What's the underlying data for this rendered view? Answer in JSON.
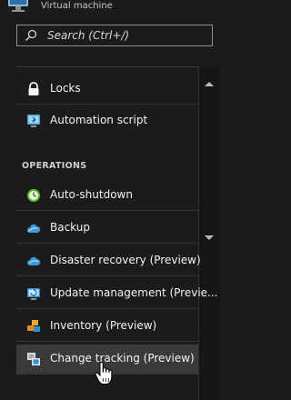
{
  "header": {
    "title": "Virtual machine",
    "icon": "monitor-icon"
  },
  "search": {
    "placeholder": "Search (Ctrl+/)"
  },
  "menu": {
    "items_top": [
      {
        "label": "Locks",
        "icon": "lock-icon"
      },
      {
        "label": "Automation script",
        "icon": "script-download-icon"
      }
    ],
    "section_operations": "OPERATIONS",
    "items_operations": [
      {
        "label": "Auto-shutdown",
        "icon": "clock-icon"
      },
      {
        "label": "Backup",
        "icon": "cloud-backup-icon"
      },
      {
        "label": "Disaster recovery (Preview)",
        "icon": "cloud-recovery-icon"
      },
      {
        "label": "Update management (Previe...",
        "icon": "update-management-icon"
      },
      {
        "label": "Inventory (Preview)",
        "icon": "inventory-icon"
      },
      {
        "label": "Change tracking (Preview)",
        "icon": "change-tracking-icon",
        "selected": true
      }
    ]
  },
  "colors": {
    "background": "#1b1b1b",
    "selected": "#3a3a3a",
    "accent": "#0078d4"
  }
}
